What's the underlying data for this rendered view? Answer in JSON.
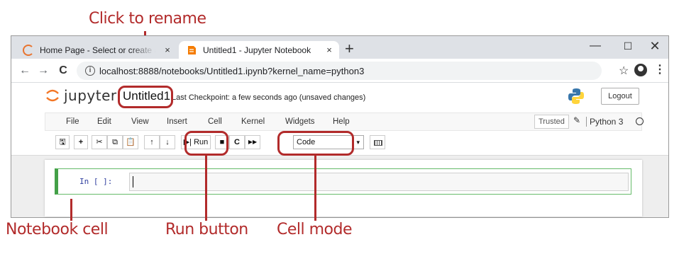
{
  "annotations": {
    "rename": "Click to rename",
    "notebook_cell": "Notebook cell",
    "run_button": "Run button",
    "cell_mode": "Cell mode",
    "color": "#b22b2b"
  },
  "browser": {
    "tabs": [
      {
        "title": "Home Page - Select or create a notebook",
        "close": "×",
        "active": false
      },
      {
        "title": "Untitled1 - Jupyter Notebook",
        "close": "×",
        "active": true
      }
    ],
    "new_tab": "+",
    "window_controls": {
      "minimize": "—",
      "maximize": "☐",
      "close": "✕"
    },
    "nav": {
      "back": "←",
      "forward": "→",
      "reload": "C"
    },
    "url": "localhost:8888/notebooks/Untitled1.ipynb?kernel_name=python3",
    "info_icon": "i",
    "star": "☆",
    "menu": "⋮"
  },
  "jupyter": {
    "brand": "jupyter",
    "notebook_name": "Untitled1",
    "checkpoint": "Last Checkpoint: a few seconds ago  (unsaved changes)",
    "logout": "Logout",
    "menus": [
      "File",
      "Edit",
      "View",
      "Insert",
      "Cell",
      "Kernel",
      "Widgets",
      "Help"
    ],
    "trusted": "Trusted",
    "pencil_icon": "✎",
    "kernel_name": "Python 3",
    "toolbar": {
      "save": "🖫",
      "add": "+",
      "cut": "✂",
      "copy": "⧉",
      "paste": "📋",
      "move_up": "↑",
      "move_down": "↓",
      "run": "▶| Run",
      "stop": "■",
      "restart": "C",
      "restart_run": "▶▶"
    },
    "cell_type": "Code",
    "cell_type_caret": "▾",
    "cell_prompt": "In [ ]:"
  }
}
